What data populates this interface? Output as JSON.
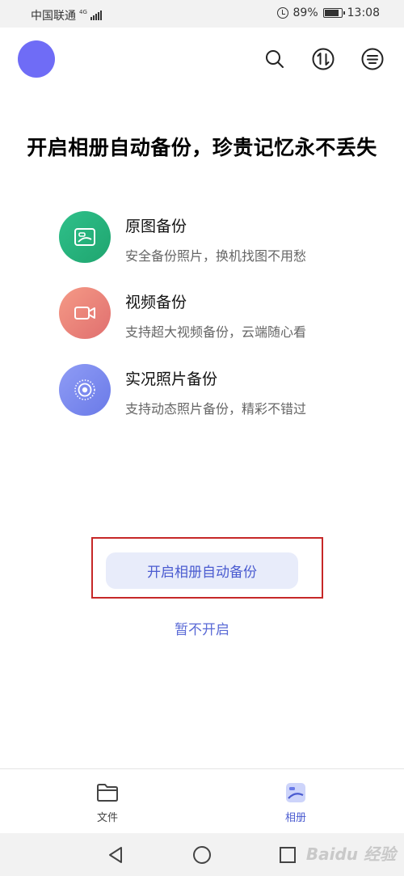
{
  "status_bar": {
    "carrier": "中国联通",
    "network": "4G",
    "battery": "89%",
    "time": "13:08"
  },
  "header": {
    "icons": [
      "search-icon",
      "transfer-icon",
      "menu-icon"
    ]
  },
  "main": {
    "headline": "开启相册自动备份，珍贵记忆永不丢失",
    "features": [
      {
        "title": "原图备份",
        "desc": "安全备份照片，换机找图不用愁",
        "icon": "image-icon",
        "color_start": "#2fc08a",
        "color_end": "#1fa56f"
      },
      {
        "title": "视频备份",
        "desc": "支持超大视频备份，云端随心看",
        "icon": "video-icon",
        "color_start": "#f59a86",
        "color_end": "#e06f6f"
      },
      {
        "title": "实况照片备份",
        "desc": "支持动态照片备份，精彩不错过",
        "icon": "live-photo-icon",
        "color_start": "#8f9cf5",
        "color_end": "#6a7ae8"
      }
    ],
    "primary_button": "开启相册自动备份",
    "secondary_link": "暂不开启"
  },
  "bottom_nav": {
    "items": [
      {
        "label": "文件",
        "icon": "folder-icon",
        "active": false
      },
      {
        "label": "相册",
        "icon": "album-icon",
        "active": true
      }
    ]
  },
  "system_nav": {
    "icons": [
      "back-icon",
      "home-icon",
      "recents-icon"
    ]
  },
  "watermark": "Baidu 经验",
  "colors": {
    "accent": "#4a5bd0",
    "button_bg": "#e8ecfa",
    "highlight_border": "#c62828",
    "avatar": "#6f6cf6"
  }
}
